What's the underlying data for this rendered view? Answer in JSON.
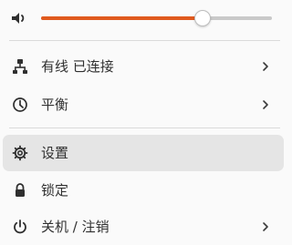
{
  "volume": {
    "level_percent": 70
  },
  "menu": {
    "network": {
      "label": "有线 已连接",
      "icon": "wired-network-icon"
    },
    "power_mode": {
      "label": "平衡",
      "icon": "power-mode-icon"
    },
    "settings": {
      "label": "设置",
      "icon": "gear-icon"
    },
    "lock": {
      "label": "锁定",
      "icon": "lock-icon"
    },
    "power": {
      "label": "关机 / 注销",
      "icon": "power-icon"
    }
  },
  "colors": {
    "accent": "#e05a1e",
    "background": "#fafafa",
    "active_item": "#e5e5e5",
    "text": "#303030"
  }
}
